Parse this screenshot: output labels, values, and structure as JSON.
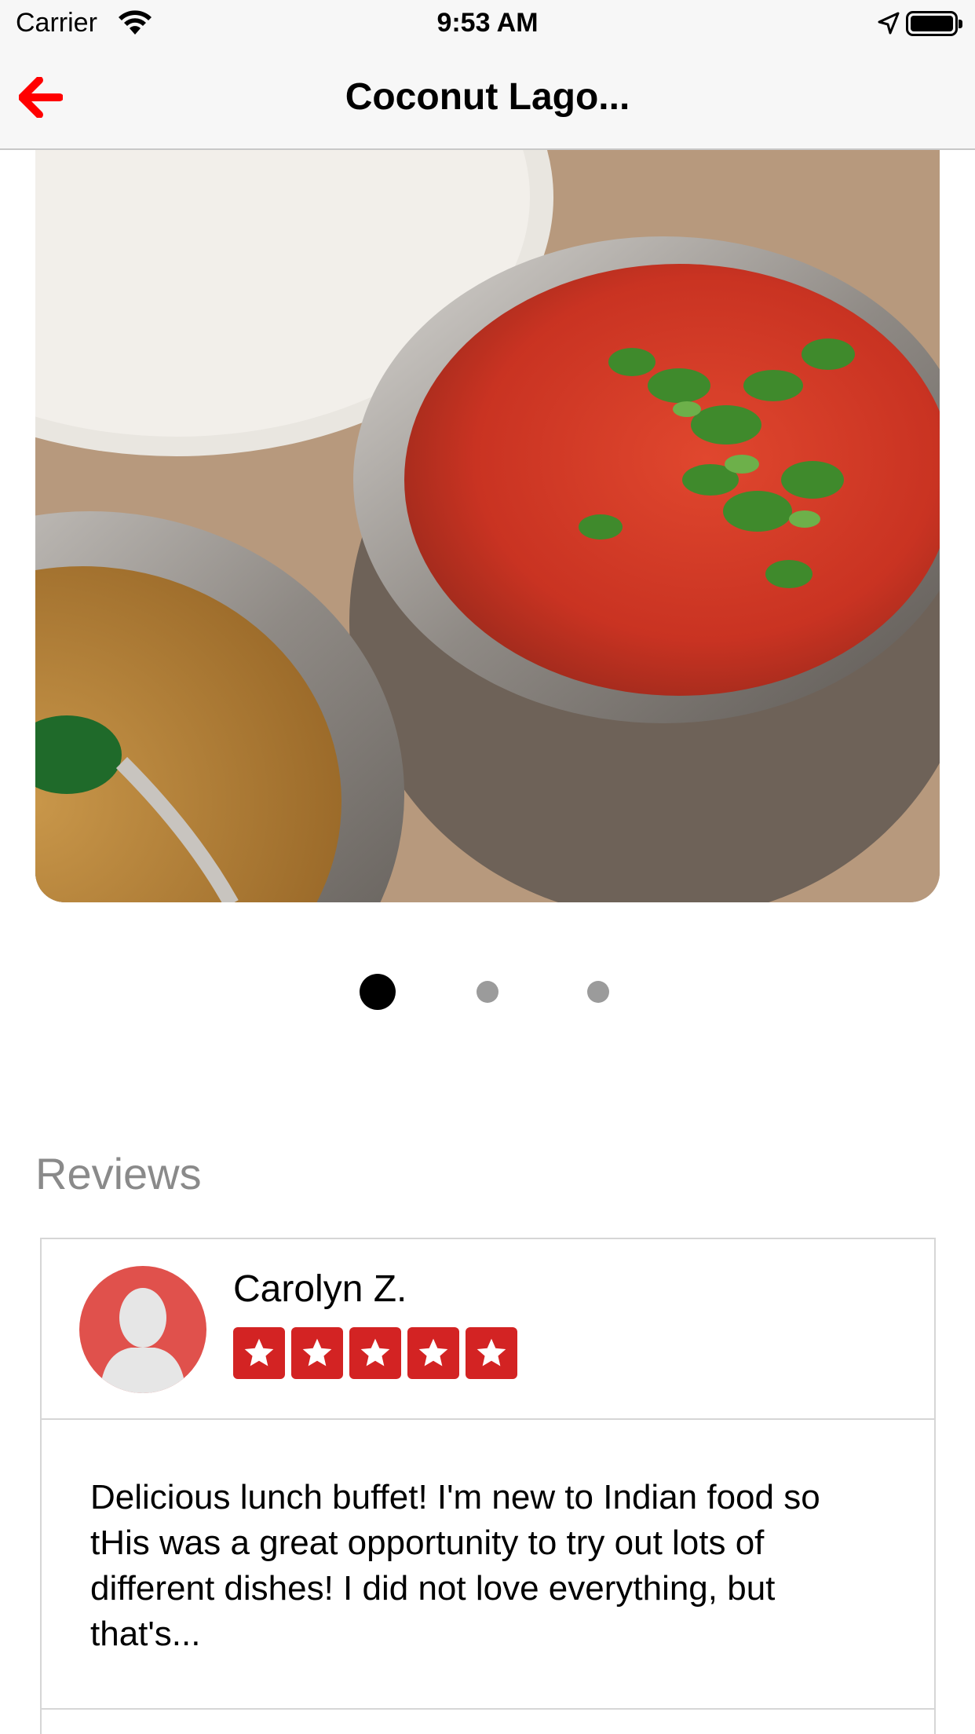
{
  "status_bar": {
    "carrier": "Carrier",
    "time": "9:53 AM"
  },
  "nav": {
    "title": "Coconut Lago..."
  },
  "carousel": {
    "page_count": 3,
    "current_page": 1
  },
  "reviews": {
    "heading": "Reviews",
    "items": [
      {
        "name": "Carolyn Z.",
        "rating": 5,
        "text": "Delicious lunch buffet! I'm new to Indian food so tHis was a great opportunity to try out lots of different dishes! I did not love everything, but that's..."
      }
    ]
  },
  "colors": {
    "accent": "#ff0000",
    "star_red": "#d32323",
    "avatar_red": "#e0514c"
  }
}
